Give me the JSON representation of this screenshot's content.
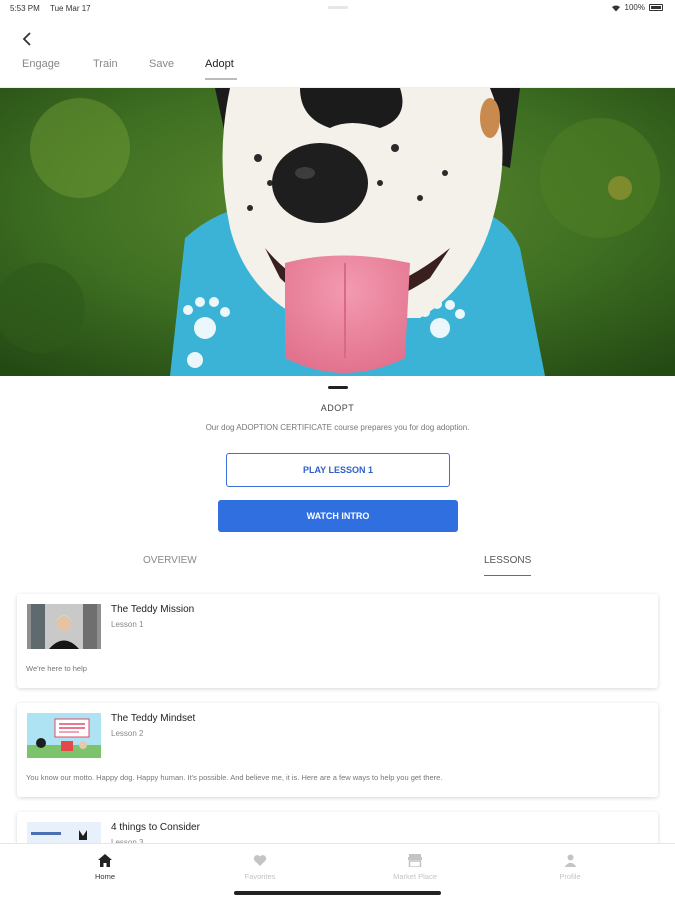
{
  "status_bar": {
    "time": "5:53 PM",
    "date": "Tue Mar 17",
    "battery": "100%"
  },
  "tabs": [
    {
      "label": "Engage"
    },
    {
      "label": "Train"
    },
    {
      "label": "Save"
    },
    {
      "label": "Adopt",
      "active": true
    }
  ],
  "course": {
    "label": "ADOPT",
    "description": "Our dog ADOPTION CERTIFICATE course prepares you for dog adoption.",
    "play_button": "PLAY LESSON 1",
    "watch_button": "WATCH INTRO"
  },
  "subtabs": {
    "overview": "OVERVIEW",
    "lessons": "LESSONS"
  },
  "lessons": [
    {
      "title": "The Teddy Mission",
      "lesson": "Lesson 1",
      "description": "We're here to help"
    },
    {
      "title": "The Teddy Mindset",
      "lesson": "Lesson 2",
      "description": "You know our motto. Happy dog. Happy human. It's possible. And believe me, it is. Here are a few ways to help you get there."
    },
    {
      "title": "4 things to Consider",
      "lesson": "Lesson 3",
      "description": ""
    }
  ],
  "bottom_nav": [
    {
      "label": "Home",
      "icon": "home-icon",
      "active": true
    },
    {
      "label": "Favorites",
      "icon": "heart-icon"
    },
    {
      "label": "Market Place",
      "icon": "store-icon"
    },
    {
      "label": "Profile",
      "icon": "person-icon"
    }
  ],
  "colors": {
    "accent": "#2f6fe0",
    "bandana": "#3bb3d6"
  }
}
